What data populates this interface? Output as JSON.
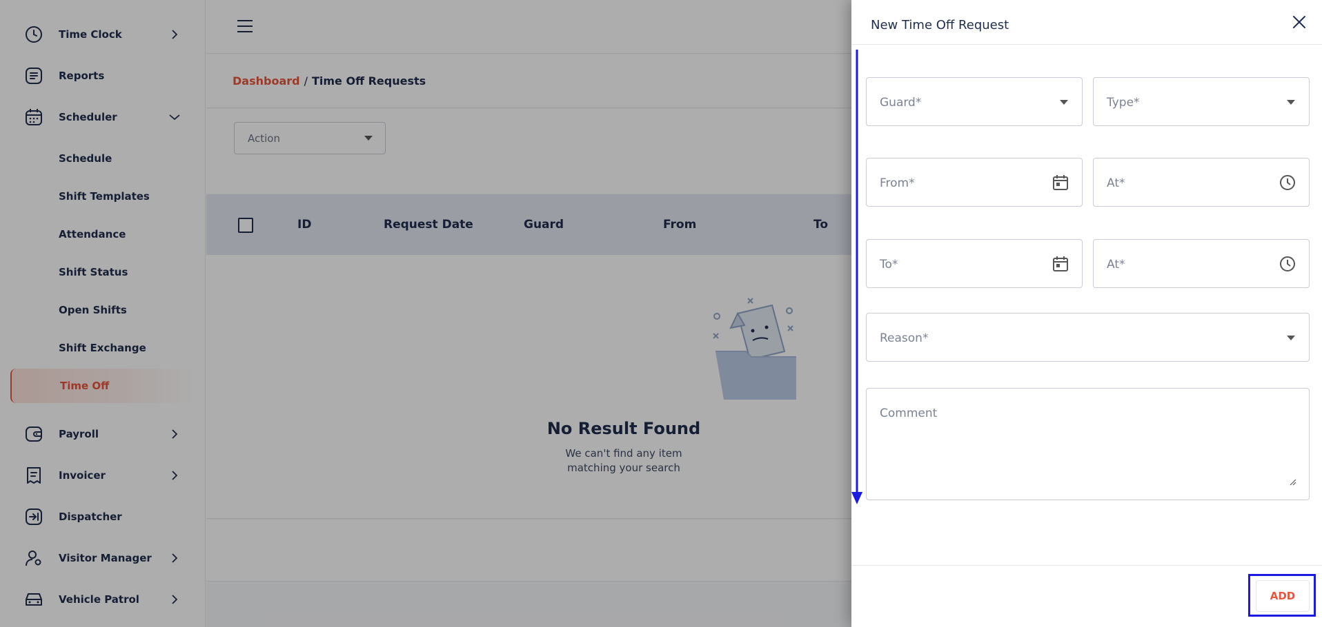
{
  "sidebar": {
    "items": [
      {
        "label": "Time Clock",
        "icon": "clock-icon",
        "chevron": "right"
      },
      {
        "label": "Reports",
        "icon": "report-icon",
        "chevron": ""
      },
      {
        "label": "Scheduler",
        "icon": "calendar-icon",
        "chevron": "down"
      },
      {
        "label": "Payroll",
        "icon": "wallet-icon",
        "chevron": "right"
      },
      {
        "label": "Invoicer",
        "icon": "receipt-icon",
        "chevron": "right"
      },
      {
        "label": "Dispatcher",
        "icon": "dispatch-icon",
        "chevron": ""
      },
      {
        "label": "Visitor Manager",
        "icon": "user-gear-icon",
        "chevron": "right"
      },
      {
        "label": "Vehicle Patrol",
        "icon": "car-icon",
        "chevron": "right"
      }
    ],
    "scheduler_subitems": [
      {
        "label": "Schedule"
      },
      {
        "label": "Shift Templates"
      },
      {
        "label": "Attendance"
      },
      {
        "label": "Shift Status"
      },
      {
        "label": "Open Shifts"
      },
      {
        "label": "Shift Exchange"
      },
      {
        "label": "Time Off",
        "active": true
      }
    ]
  },
  "breadcrumb": {
    "link": "Dashboard",
    "separator": "/",
    "current": "Time Off Requests"
  },
  "filter": {
    "action_label": "Action"
  },
  "table": {
    "columns": [
      "ID",
      "Request Date",
      "Guard",
      "From",
      "To"
    ]
  },
  "empty_state": {
    "title": "No Result Found",
    "line1": "We can't find any item",
    "line2": "matching your search"
  },
  "drawer": {
    "title": "New Time Off Request",
    "fields": {
      "guard": {
        "placeholder": "Guard*"
      },
      "type": {
        "placeholder": "Type*"
      },
      "from": {
        "placeholder": "From*"
      },
      "from_at": {
        "placeholder": "At*"
      },
      "to": {
        "placeholder": "To*"
      },
      "to_at": {
        "placeholder": "At*"
      },
      "reason": {
        "placeholder": "Reason*"
      },
      "comment": {
        "placeholder": "Comment"
      }
    },
    "add_label": "ADD"
  },
  "colors": {
    "accent": "#e8553b",
    "navy": "#1f2d4d",
    "table_header_bg": "#e4e8f2",
    "annotation_blue": "#1a1ae0"
  }
}
